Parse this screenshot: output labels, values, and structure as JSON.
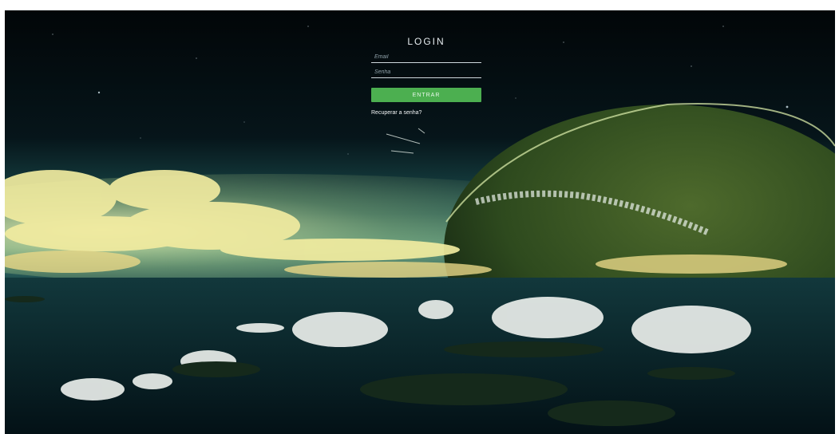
{
  "login": {
    "title": "LOGIN",
    "email_placeholder": "Email",
    "password_placeholder": "Senha",
    "submit_label": "ENTRAR",
    "recover_label": "Recuperar a senha?",
    "button_color": "#4caf50"
  },
  "background": {
    "icons": [
      "planet-image",
      "clouds-image",
      "islands-image",
      "stars-image"
    ]
  }
}
